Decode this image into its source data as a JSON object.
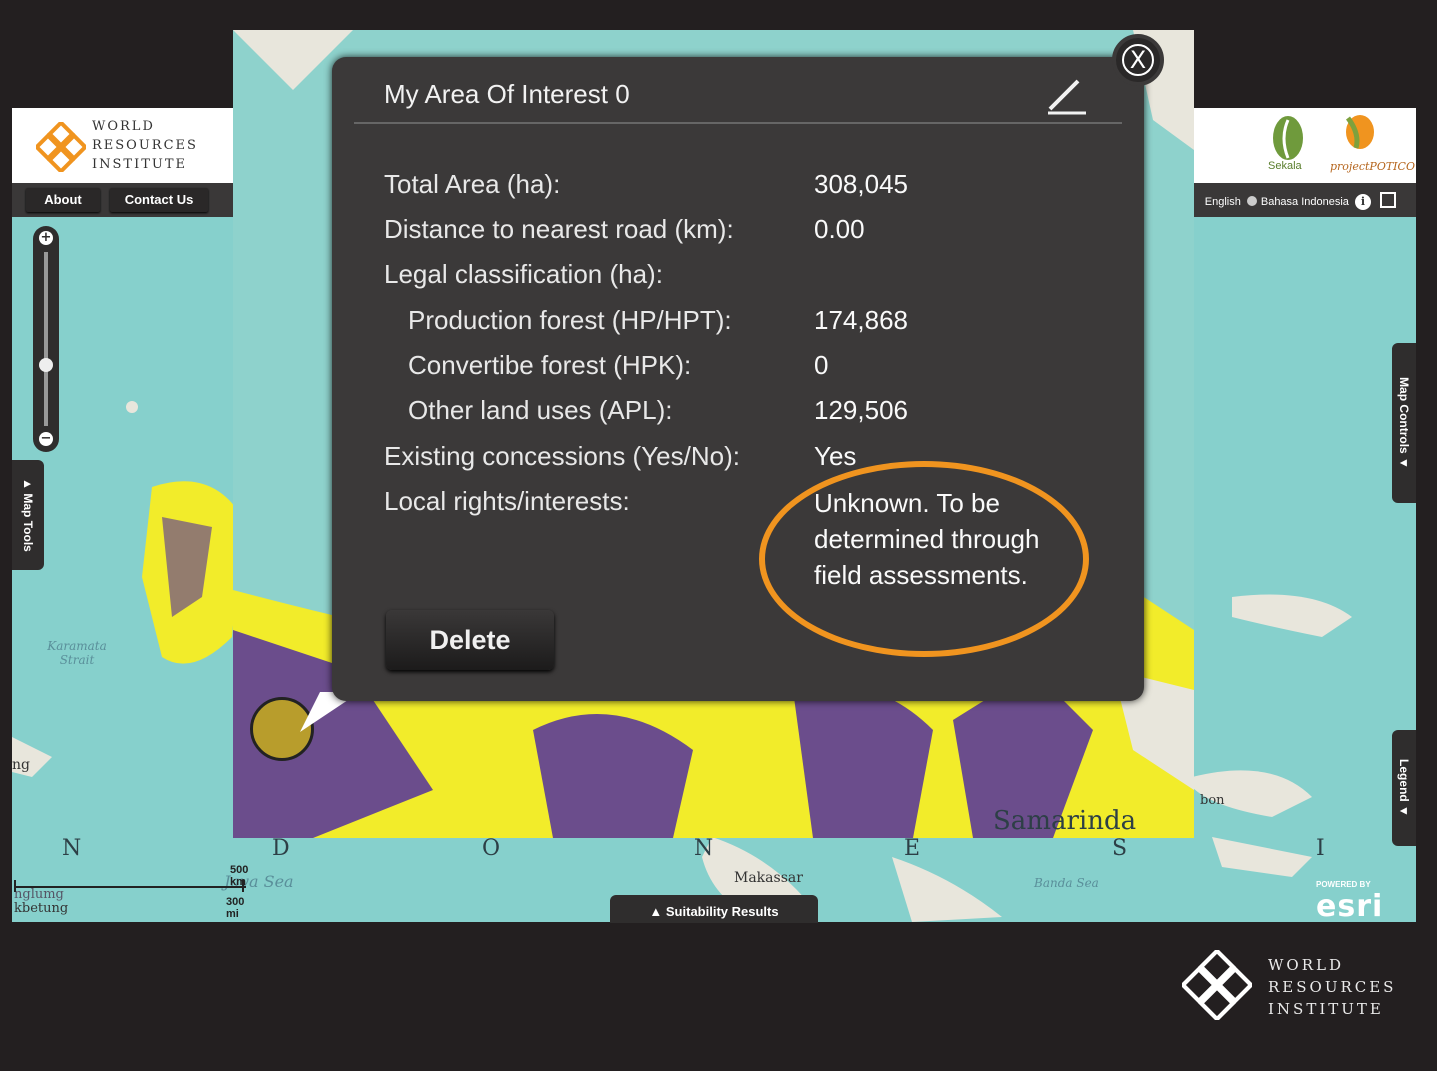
{
  "header": {
    "org_name": [
      "WORLD",
      "RESOURCES",
      "INSTITUTE"
    ],
    "partners": [
      "Sekala",
      "projectPOTICO"
    ]
  },
  "nav": {
    "buttons": [
      "About",
      "Contact Us"
    ],
    "languages": [
      "English",
      "Bahasa Indonesia"
    ]
  },
  "map": {
    "tabs": {
      "map_tools": "▲ Map Tools",
      "map_controls": "Map Controls ▼",
      "legend": "Legend ▼"
    },
    "labels": [
      "Karamata Strait",
      "Java Sea",
      "Makassar",
      "Banda Sea",
      "ng",
      "bon"
    ],
    "country_letters": [
      "N",
      "D",
      "O",
      "N",
      "E",
      "S",
      "I"
    ],
    "scale": {
      "km": "500 km",
      "mi": "300 mi"
    },
    "place_left": [
      "nglumg",
      "kbetung"
    ],
    "zoom_city": "Samarinda",
    "suitability_button": "▲ Suitability Results",
    "powered_by": "POWERED BY",
    "esri": "esri"
  },
  "popup": {
    "title": "My Area Of Interest 0",
    "rows": [
      {
        "label": "Total Area (ha):",
        "value": "308,045"
      },
      {
        "label": "Distance to nearest road (km):",
        "value": "0.00"
      },
      {
        "label": "Legal classification (ha):",
        "value": ""
      },
      {
        "label": "Production forest (HP/HPT):",
        "value": "174,868"
      },
      {
        "label": "Convertibe forest (HPK):",
        "value": "0"
      },
      {
        "label": "Other land uses (APL):",
        "value": "129,506"
      },
      {
        "label": "Existing concessions (Yes/No):",
        "value": "Yes"
      },
      {
        "label": "Local rights/interests:",
        "value": "Unknown. To be determined through field assessments."
      }
    ],
    "delete_label": "Delete",
    "close_label": "X"
  },
  "colors": {
    "highlight": "#f0941f",
    "suitable": "#f2ec2a",
    "unsuitable": "#6b4d8c",
    "sea": "#8ed2cc"
  },
  "footer": {
    "org_name": [
      "WORLD",
      "RESOURCES",
      "INSTITUTE"
    ]
  }
}
